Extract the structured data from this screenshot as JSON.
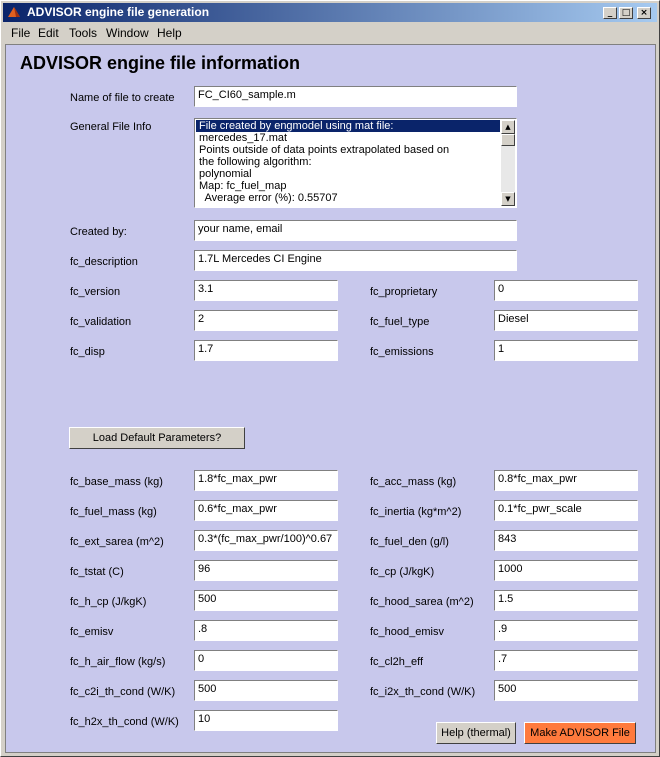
{
  "window": {
    "title": "ADVISOR engine file generation"
  },
  "menu": [
    "File",
    "Edit",
    "Tools",
    "Window",
    "Help"
  ],
  "heading": "ADVISOR engine file information",
  "filename": {
    "label": "Name of file to create",
    "value": "FC_CI60_sample.m"
  },
  "general_info": {
    "label": "General File Info",
    "lines": [
      "File created by engmodel using mat file:",
      "mercedes_17.mat",
      "Points outside of data points extrapolated based on",
      "the following algorithm:",
      "polynomial",
      "Map: fc_fuel_map",
      "  Average error (%): 0.55707"
    ]
  },
  "created_by": {
    "label": "Created by:",
    "value": "your name, email"
  },
  "description": {
    "label": "fc_description",
    "value": "1.7L Mercedes CI Engine"
  },
  "top_fields": [
    {
      "left_label": "fc_version",
      "left_value": "3.1",
      "right_label": "fc_proprietary",
      "right_value": "0"
    },
    {
      "left_label": "fc_validation",
      "left_value": "2",
      "right_label": "fc_fuel_type",
      "right_value": "Diesel"
    },
    {
      "left_label": "fc_disp",
      "left_value": "1.7",
      "right_label": "fc_emissions",
      "right_value": "1"
    }
  ],
  "load_button": "Load Default Parameters?",
  "params": [
    {
      "left_label": "fc_base_mass (kg)",
      "left_value": "1.8*fc_max_pwr",
      "right_label": "fc_acc_mass (kg)",
      "right_value": "0.8*fc_max_pwr"
    },
    {
      "left_label": "fc_fuel_mass (kg)",
      "left_value": "0.6*fc_max_pwr",
      "right_label": "fc_inertia (kg*m^2)",
      "right_value": "0.1*fc_pwr_scale"
    },
    {
      "left_label": "fc_ext_sarea (m^2)",
      "left_value": "0.3*(fc_max_pwr/100)^0.67",
      "right_label": "fc_fuel_den (g/l)",
      "right_value": "843"
    },
    {
      "left_label": "fc_tstat (C)",
      "left_value": "96",
      "right_label": "fc_cp (J/kgK)",
      "right_value": "1000"
    },
    {
      "left_label": "fc_h_cp (J/kgK)",
      "left_value": "500",
      "right_label": "fc_hood_sarea (m^2)",
      "right_value": "1.5"
    },
    {
      "left_label": "fc_emisv",
      "left_value": ".8",
      "right_label": "fc_hood_emisv",
      "right_value": ".9"
    },
    {
      "left_label": "fc_h_air_flow (kg/s)",
      "left_value": "0",
      "right_label": "fc_cl2h_eff",
      "right_value": ".7"
    },
    {
      "left_label": "fc_c2i_th_cond (W/K)",
      "left_value": "500",
      "right_label": "fc_i2x_th_cond (W/K)",
      "right_value": "500"
    }
  ],
  "last_param": {
    "label": "fc_h2x_th_cond (W/K)",
    "value": "10"
  },
  "help_button": "Help (thermal)",
  "make_button": "Make ADVISOR File",
  "colors": {
    "title_bar": "#0a246a",
    "client_bg": "#c8c8ec",
    "make_button": "#ff7a3d"
  }
}
